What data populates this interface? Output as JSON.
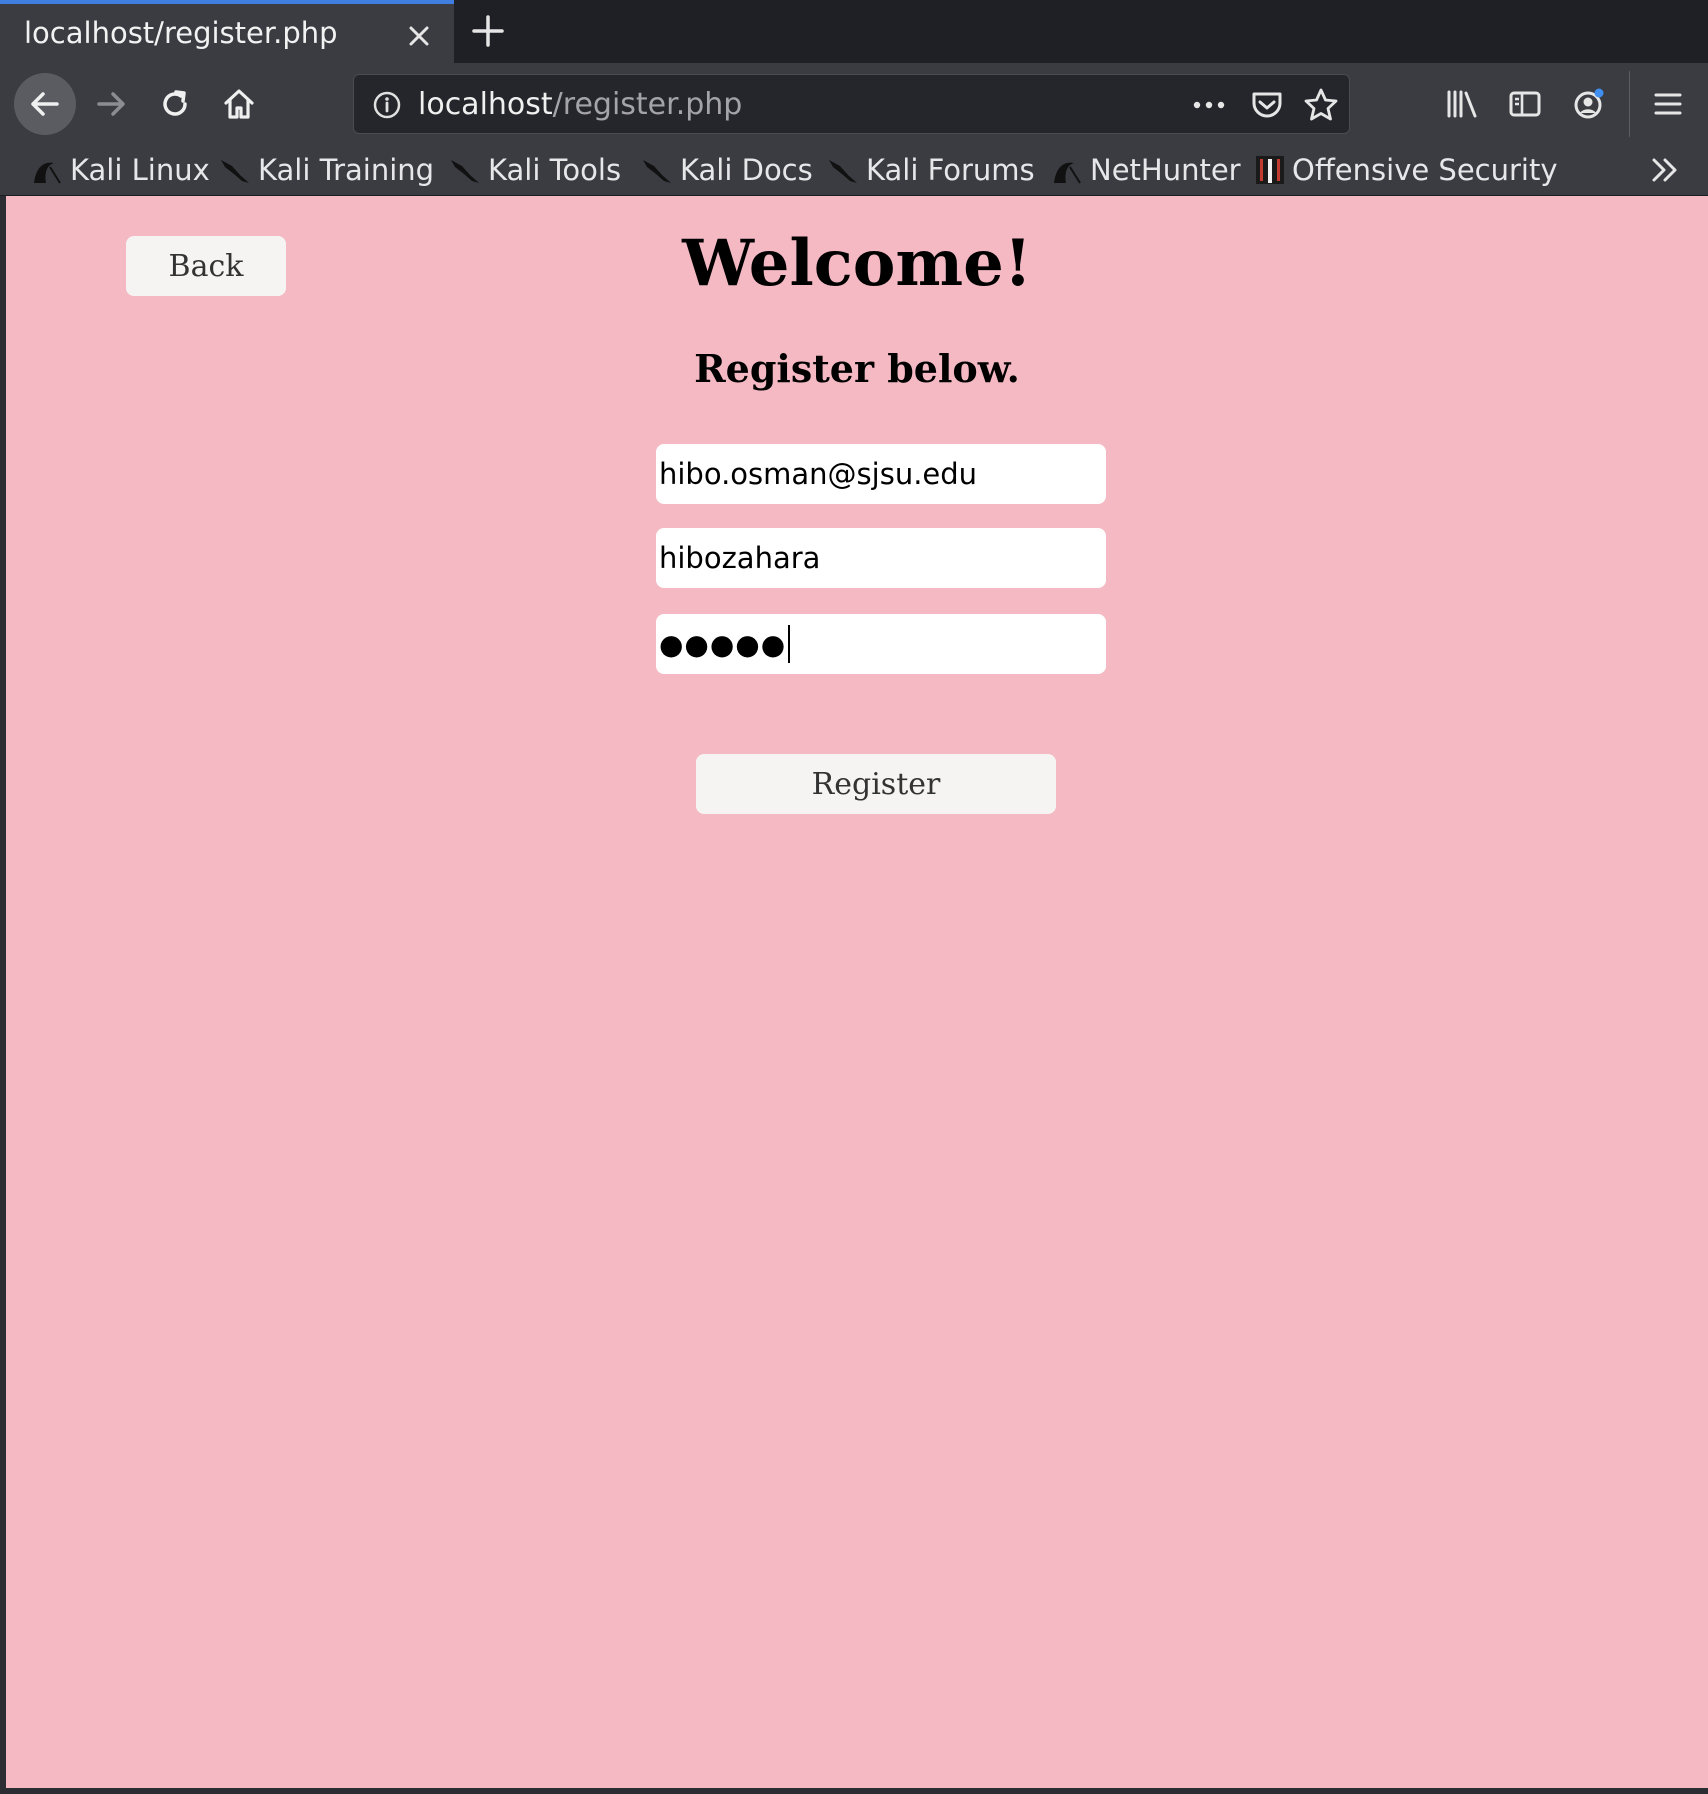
{
  "browser": {
    "tab_title": "localhost/register.php",
    "url_host": "localhost",
    "url_path": "/register.php",
    "bookmarks": [
      {
        "label": "Kali Linux",
        "icon": "kali-icon"
      },
      {
        "label": "Kali Training",
        "icon": "kali-dragon-icon"
      },
      {
        "label": "Kali Tools",
        "icon": "kali-dragon-icon"
      },
      {
        "label": "Kali Docs",
        "icon": "kali-dragon-icon"
      },
      {
        "label": "Kali Forums",
        "icon": "kali-dragon-icon"
      },
      {
        "label": "NetHunter",
        "icon": "kali-icon"
      },
      {
        "label": "Offensive Security",
        "icon": "offsec-icon"
      }
    ]
  },
  "page": {
    "background": "#f4b9c3",
    "back_label": "Back",
    "title": "Welcome!",
    "subtitle": "Register below.",
    "email_value": "hibo.osman@sjsu.edu",
    "username_value": "hibozahara",
    "password_mask": "●●●●●",
    "register_label": "Register"
  }
}
